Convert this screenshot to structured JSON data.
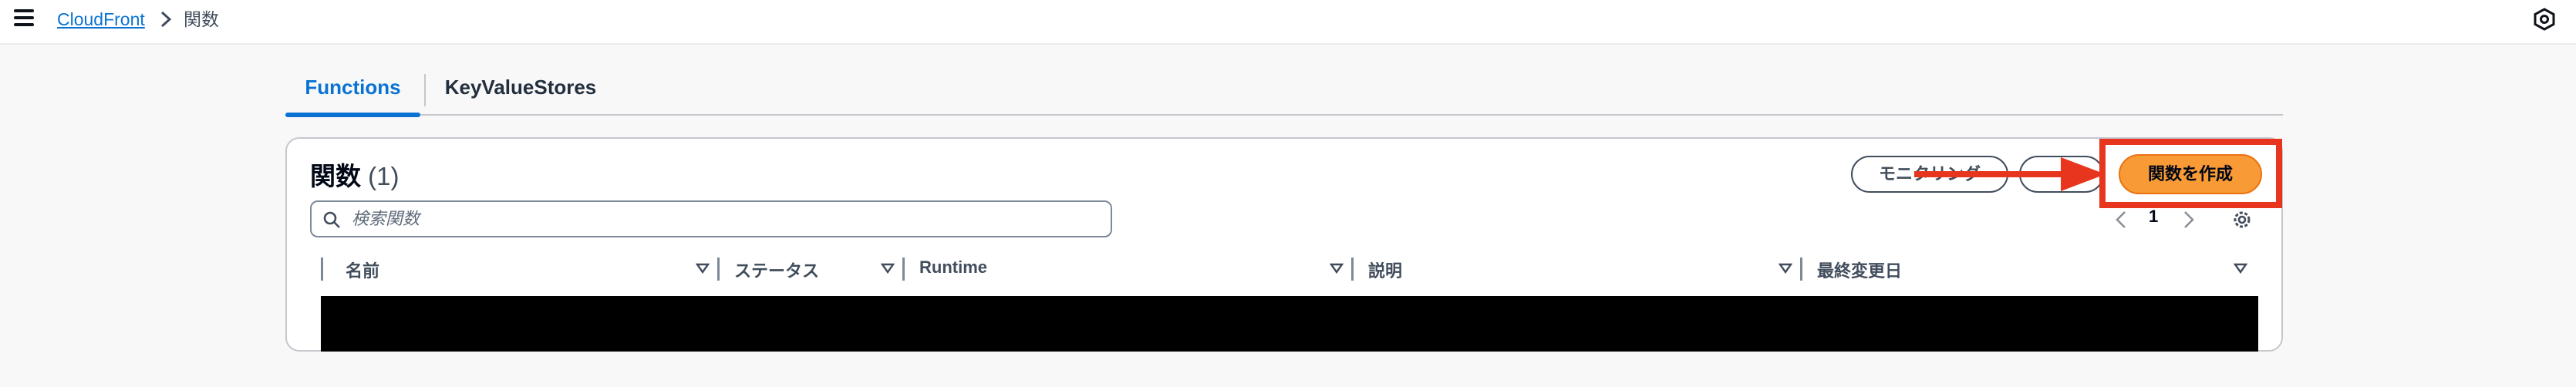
{
  "breadcrumb": {
    "root": "CloudFront",
    "current": "関数"
  },
  "icons": {
    "menu": "hamburger-menu-icon",
    "breadcrumb_separator": "chevron-right-icon",
    "top_right": "notifications-hexagon-icon",
    "search": "search-icon",
    "pager_prev": "chevron-left-icon",
    "pager_next": "chevron-right-icon",
    "settings": "gear-icon",
    "sort": "caret-down-icon"
  },
  "tabs": [
    {
      "label": "Functions",
      "active": true
    },
    {
      "label": "KeyValueStores",
      "active": false
    }
  ],
  "panel": {
    "title": "関数",
    "count": "(1)",
    "buttons": {
      "monitoring": "モニタリング",
      "secondary": "",
      "create": "関数を作成"
    },
    "search_placeholder": "検索関数",
    "pager": {
      "page": "1"
    }
  },
  "table": {
    "columns": [
      "名前",
      "ステータス",
      "Runtime",
      "説明",
      "最終変更日"
    ]
  },
  "colors": {
    "accent": "#0972d3",
    "primary_button": "#f89a35",
    "annotation": "#e8351d"
  }
}
